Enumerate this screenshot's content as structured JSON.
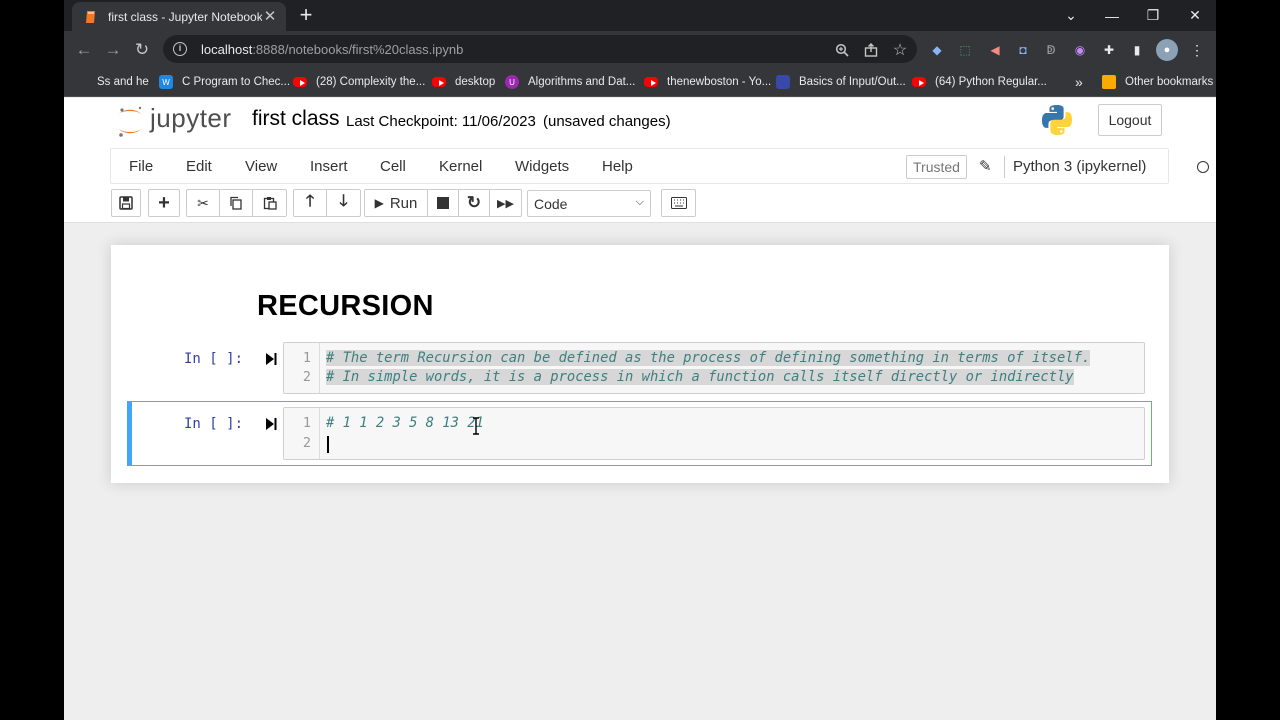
{
  "browser": {
    "tab_title": "first class - Jupyter Notebook",
    "url_host": "localhost",
    "url_rest": ":8888/notebooks/first%20class.ipynb",
    "bookmarks": [
      "Ss and he",
      "C Program to Chec...",
      "(28) Complexity the...",
      "desktop",
      "Algorithms and Dat...",
      "thenewboston - Yo...",
      "Basics of Input/Out...",
      "(64) Python Regular...",
      "»",
      "Other bookmarks"
    ]
  },
  "jupyter": {
    "logo_text": "jupyter",
    "notebook_name": "first class",
    "checkpoint": "Last Checkpoint: 11/06/2023",
    "unsaved": "(unsaved changes)",
    "logout": "Logout",
    "menus": [
      "File",
      "Edit",
      "View",
      "Insert",
      "Cell",
      "Kernel",
      "Widgets",
      "Help"
    ],
    "trusted": "Trusted",
    "kernel_name": "Python 3 (ipykernel)",
    "run_label": "Run",
    "cell_type": "Code"
  },
  "notebook": {
    "heading": "RECURSION",
    "cells": [
      {
        "prompt": "In [ ]:",
        "lines": [
          {
            "no": "1",
            "text": "# The term Recursion can be defined as the process of defining something in terms of itself."
          },
          {
            "no": "2",
            "text": "# In simple words, it is a process in which a function calls itself directly or indirectly"
          }
        ]
      },
      {
        "prompt": "In [ ]:",
        "lines": [
          {
            "no": "1",
            "text": "# 1 1 2 3 5 8 13 21"
          },
          {
            "no": "2",
            "text": ""
          }
        ]
      }
    ]
  },
  "colors": {
    "comment": "#408080",
    "prompt_in": "#303f9f",
    "selected_cell_border": "#66bb6a",
    "selected_cell_bar": "#42a5f5"
  }
}
